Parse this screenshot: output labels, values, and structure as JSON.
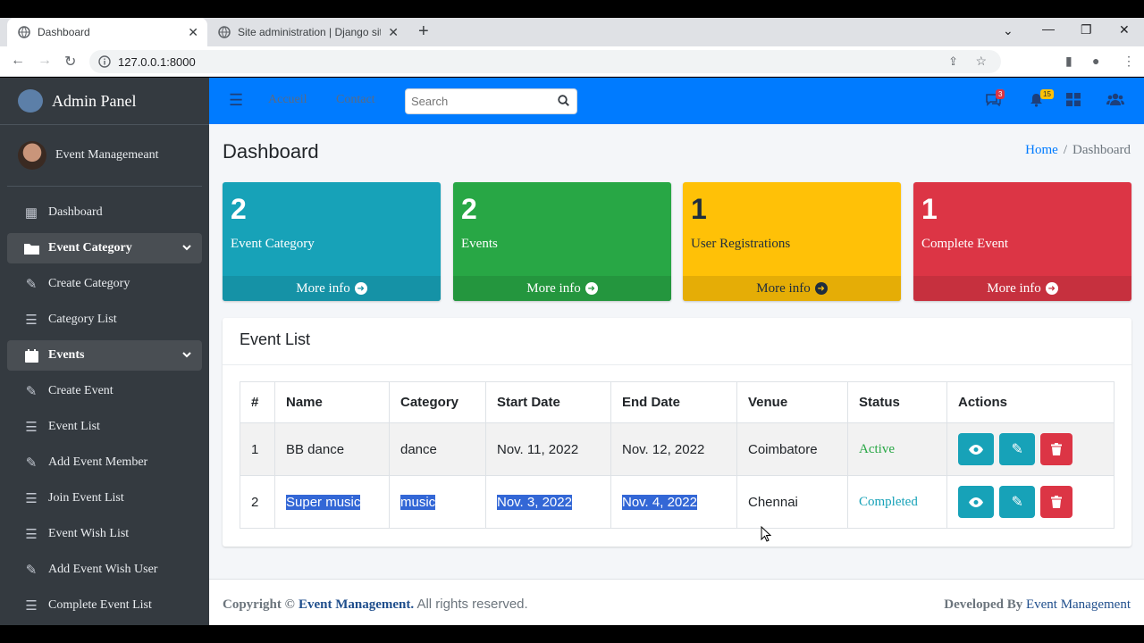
{
  "browser": {
    "tabs": [
      {
        "title": "Dashboard",
        "active": true
      },
      {
        "title": "Site administration | Django site"
      }
    ],
    "new_tab": "+",
    "address": "127.0.0.1:8000"
  },
  "sidebar": {
    "brand": "Admin Panel",
    "user": "Event Managemeant",
    "items": [
      {
        "label": "Dashboard",
        "icon": "grid-icon"
      },
      {
        "label": "Event Category",
        "icon": "folder-icon",
        "expandable": true
      },
      {
        "label": "Create Category",
        "icon": "edit-icon"
      },
      {
        "label": "Category List",
        "icon": "list-icon"
      },
      {
        "label": "Events",
        "icon": "calendar-icon",
        "expandable": true
      },
      {
        "label": "Create Event",
        "icon": "edit-icon"
      },
      {
        "label": "Event List",
        "icon": "list-icon"
      },
      {
        "label": "Add Event Member",
        "icon": "edit-icon"
      },
      {
        "label": "Join Event List",
        "icon": "list-icon"
      },
      {
        "label": "Event Wish List",
        "icon": "list-icon"
      },
      {
        "label": "Add Event Wish User",
        "icon": "edit-icon"
      },
      {
        "label": "Complete Event List",
        "icon": "list-icon"
      }
    ]
  },
  "topnav": {
    "links": [
      "Accueil",
      "Contact"
    ],
    "search_placeholder": "Search",
    "messages_count": "3",
    "notifications_count": "15"
  },
  "page": {
    "title": "Dashboard",
    "breadcrumb_home": "Home",
    "breadcrumb_sep": "/",
    "breadcrumb_current": "Dashboard"
  },
  "stats": [
    {
      "value": "2",
      "label": "Event Category",
      "more": "More info",
      "color": "#17a2b8",
      "footer_color": "#1592a6"
    },
    {
      "value": "2",
      "label": "Events",
      "more": "More info",
      "color": "#28a745",
      "footer_color": "#24963e"
    },
    {
      "value": "1",
      "label": "User Registrations",
      "more": "More info",
      "color": "#ffc107",
      "footer_color": "#e5ad06"
    },
    {
      "value": "1",
      "label": "Complete Event",
      "more": "More info",
      "color": "#dc3545",
      "footer_color": "#c6303e"
    }
  ],
  "event_list": {
    "title": "Event List",
    "columns": [
      "#",
      "Name",
      "Category",
      "Start Date",
      "End Date",
      "Venue",
      "Status",
      "Actions"
    ],
    "rows": [
      {
        "num": "1",
        "name": "BB dance",
        "category": "dance",
        "start": "Nov. 11, 2022",
        "end": "Nov. 12, 2022",
        "venue": "Coimbatore",
        "status": "Active",
        "status_color": "#28a745"
      },
      {
        "num": "2",
        "name": "Super music",
        "category": "music",
        "start": "Nov. 3, 2022",
        "end": "Nov. 4, 2022",
        "venue": "Chennai",
        "status": "Completed",
        "status_color": "#17a2b8"
      }
    ]
  },
  "footer": {
    "copyright": "Copyright ©",
    "brand": "Event Management.",
    "rights": "All rights reserved.",
    "developed_by": "Developed By",
    "developer": "Event Management"
  }
}
